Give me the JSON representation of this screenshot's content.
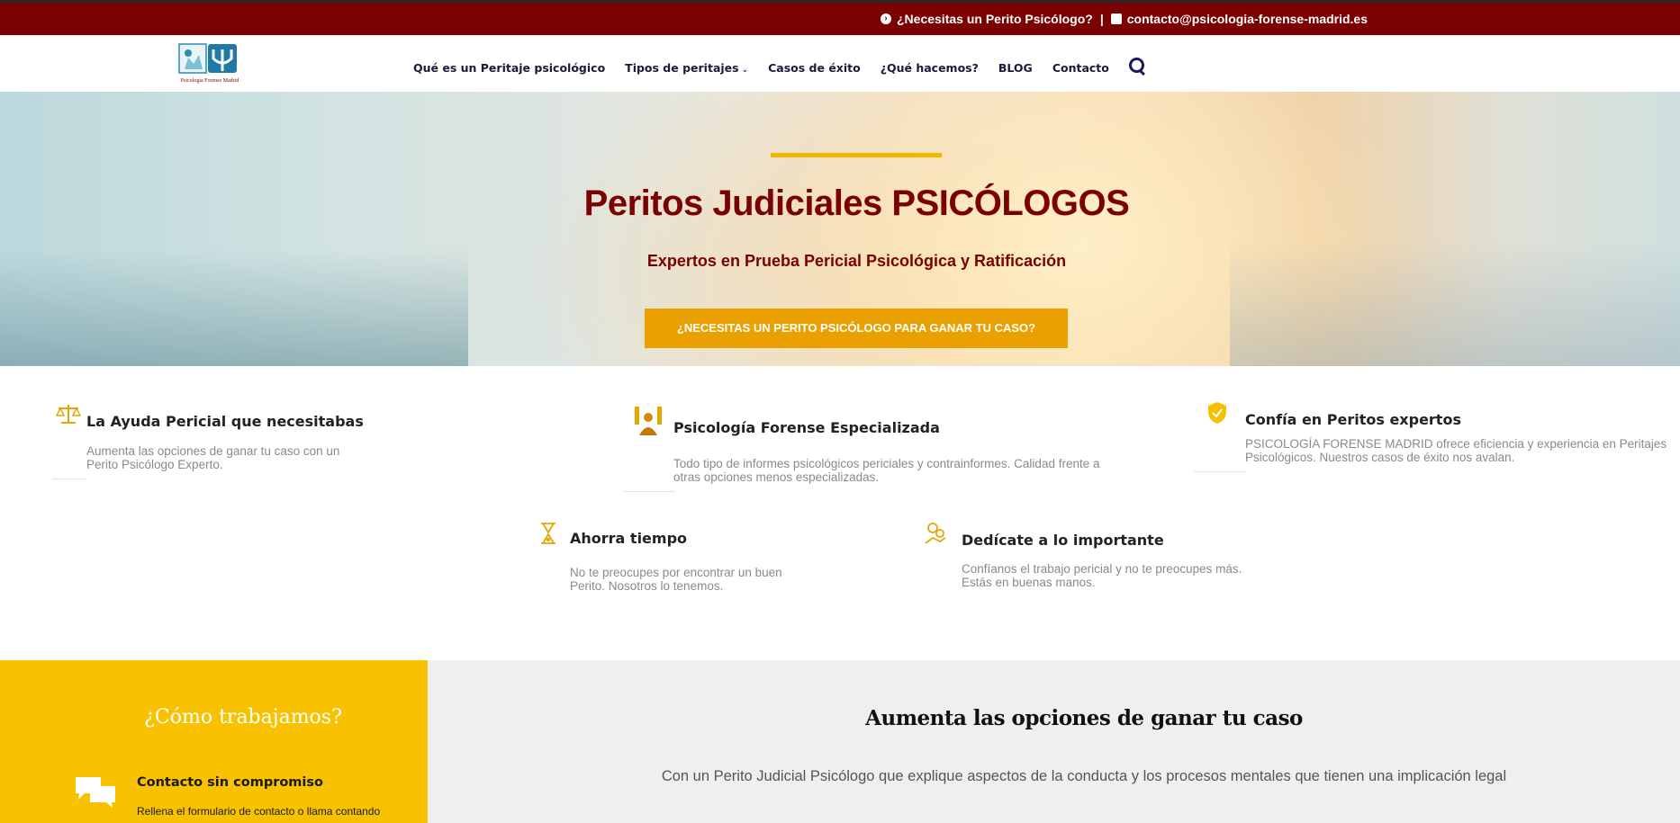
{
  "topbar": {
    "question": "¿Necesitas un Perito Psicólogo?",
    "separator": "|",
    "email": "contacto@psicologia-forense-madrid.es",
    "icon_question": "chevron-circle-right-icon",
    "icon_email": "envelope-icon"
  },
  "logo": {
    "text": "Psicología Forense Madrid"
  },
  "nav": {
    "items": [
      {
        "label": "Qué es un Peritaje psicológico"
      },
      {
        "label": "Tipos de peritajes"
      },
      {
        "label": "Casos de éxito"
      },
      {
        "label": "¿Qué hacemos?"
      },
      {
        "label": "BLOG"
      },
      {
        "label": "Contacto"
      }
    ],
    "search_icon": "search-icon"
  },
  "hero": {
    "title": "Peritos Judiciales PSICÓLOGOS",
    "subtitle": "Expertos en Prueba Pericial Psicológica y Ratificación",
    "cta": "¿NECESITAS UN PERITO PSICÓLOGO PARA GANAR TU CASO?"
  },
  "features": [
    {
      "title": "La Ayuda Pericial que necesitabas",
      "desc": "Aumenta las opciones de ganar tu caso con un Perito Psicólogo Experto.",
      "icon": "scales-icon"
    },
    {
      "title": "Psicología Forense Especializada",
      "desc": "Todo tipo de informes psicológicos periciales y contrainformes. Calidad frente a otras opciones menos especializadas.",
      "icon": "people-icon"
    },
    {
      "title": "Confía en Peritos expertos",
      "desc": "PSICOLOGÍA FORENSE MADRID ofrece eficiencia y experiencia en Peritajes Psicológicos. Nuestros casos de éxito nos avalan.",
      "icon": "shield-check-icon"
    },
    {
      "title": "Ahorra tiempo",
      "desc": "No te preocupes por encontrar un buen Perito. Nosotros lo tenemos.",
      "icon": "hourglass-icon"
    },
    {
      "title": "Dedícate a lo importante",
      "desc": "Confíanos el trabajo pericial y no te preocupes más. Estás en buenas manos.",
      "icon": "money-hand-icon"
    }
  ],
  "how": {
    "title": "¿Cómo trabajamos?",
    "step_title": "Contacto sin compromiso",
    "step_desc": "Rellena el formulario de contacto o llama contando",
    "icon": "chat-bubbles-icon"
  },
  "win": {
    "title": "Aumenta las opciones de ganar tu caso",
    "text": "Con un Perito Judicial Psicólogo que explique aspectos de la conducta y los procesos mentales que tienen una implicación legal"
  },
  "colors": {
    "brand_red": "#7b0000",
    "accent_yellow": "#f8c200",
    "cta_orange": "#eaa000",
    "icon_gold": "#e5a600"
  }
}
